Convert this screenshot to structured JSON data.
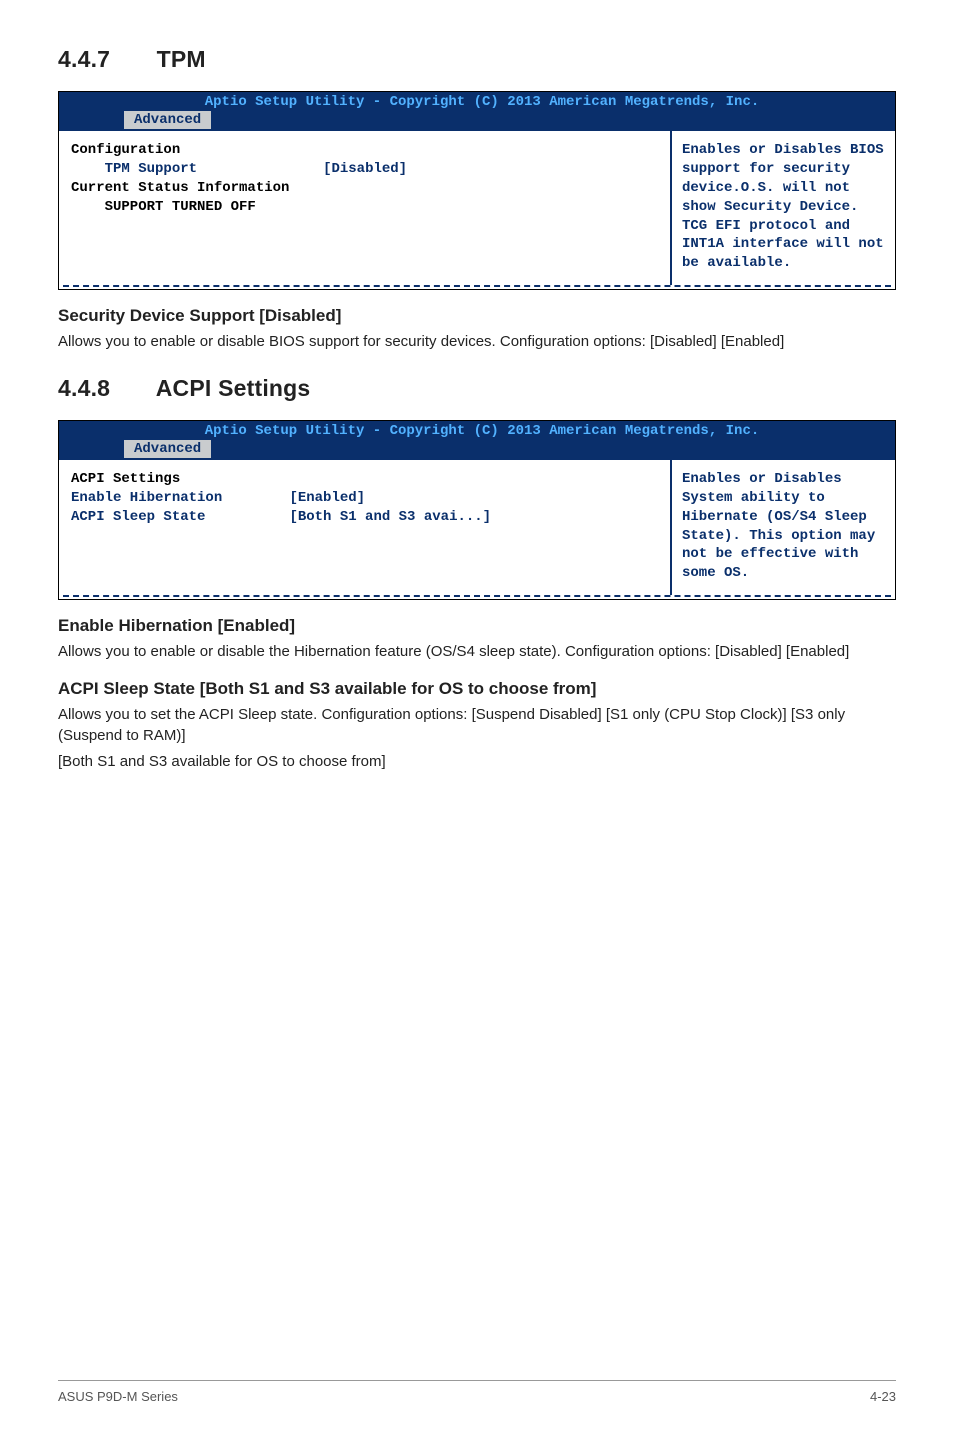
{
  "section1": {
    "num": "4.4.7",
    "title": "TPM"
  },
  "bios1": {
    "title": "Aptio Setup Utility - Copyright (C) 2013 American Megatrends, Inc.",
    "tab": "Advanced",
    "left": {
      "l1": "Configuration",
      "l2_label": "    TPM Support",
      "l2_value": "[Disabled]",
      "l3": "",
      "l4": "Current Status Information",
      "l5": "    SUPPORT TURNED OFF"
    },
    "help": "Enables or Disables BIOS support for security device.O.S. will not show Security Device. TCG EFI protocol and INT1A interface will not be available."
  },
  "sec_dev": {
    "head": "Security Device Support [Disabled]",
    "p1": "Allows you to enable or disable BIOS support for security devices. Configuration options: [Disabled] [Enabled]"
  },
  "section2": {
    "num": "4.4.8",
    "title": "ACPI Settings"
  },
  "bios2": {
    "title": "Aptio Setup Utility - Copyright (C) 2013 American Megatrends, Inc.",
    "tab": "Advanced",
    "left": {
      "l1": "ACPI Settings",
      "l2_label": "Enable Hibernation",
      "l2_value": "[Enabled]",
      "l3_label": "ACPI Sleep State",
      "l3_value": "[Both S1 and S3 avai...]"
    },
    "help": "Enables or Disables System ability to Hibernate (OS/S4 Sleep State). This option may not be effective with some OS."
  },
  "hib": {
    "head": "Enable Hibernation [Enabled]",
    "p1": "Allows you to enable or disable the Hibernation feature (OS/S4 sleep state). Configuration options: [Disabled] [Enabled]"
  },
  "acpi_sleep": {
    "head": "ACPI Sleep State [Both S1 and S3 available for OS to choose from]",
    "p1": "Allows you to set the ACPI Sleep state. Configuration options: [Suspend Disabled] [S1 only (CPU Stop Clock)] [S3 only (Suspend to RAM)]",
    "p2": "[Both S1 and S3 available for OS to choose from]"
  },
  "footer": {
    "left": "ASUS P9D-M Series",
    "right": "4-23"
  }
}
